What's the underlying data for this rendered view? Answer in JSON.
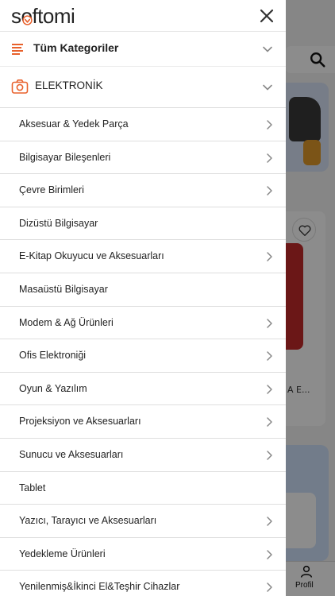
{
  "drawer": {
    "logo_text": "softomi",
    "all_categories_label": "Tüm Kategoriler",
    "section_label": "ELEKTRONİK",
    "categories": [
      {
        "label": "Aksesuar & Yedek Parça",
        "has_children": true
      },
      {
        "label": "Bilgisayar Bileşenleri",
        "has_children": true
      },
      {
        "label": "Çevre Birimleri",
        "has_children": true
      },
      {
        "label": "Dizüstü Bilgisayar",
        "has_children": false
      },
      {
        "label": "E-Kitap Okuyucu ve Aksesuarları",
        "has_children": true
      },
      {
        "label": "Masaüstü Bilgisayar",
        "has_children": false
      },
      {
        "label": "Modem & Ağ Ürünleri",
        "has_children": true
      },
      {
        "label": "Ofis Elektroniği",
        "has_children": true
      },
      {
        "label": "Oyun & Yazılım",
        "has_children": true
      },
      {
        "label": "Projeksiyon ve Aksesuarları",
        "has_children": true
      },
      {
        "label": "Sunucu ve Aksesuarları",
        "has_children": true
      },
      {
        "label": "Tablet",
        "has_children": false
      },
      {
        "label": "Yazıcı, Tarayıcı ve Aksesuarları",
        "has_children": true
      },
      {
        "label": "Yedekleme Ürünleri",
        "has_children": true
      },
      {
        "label": "Yenilenmiş&İkinci El&Teşhir Cihazlar",
        "has_children": true
      }
    ]
  },
  "background": {
    "product_title_fragment": "A E...",
    "tab_profile_label": "Profil"
  },
  "colors": {
    "accent": "#e8612c",
    "overlay": "#000000"
  }
}
